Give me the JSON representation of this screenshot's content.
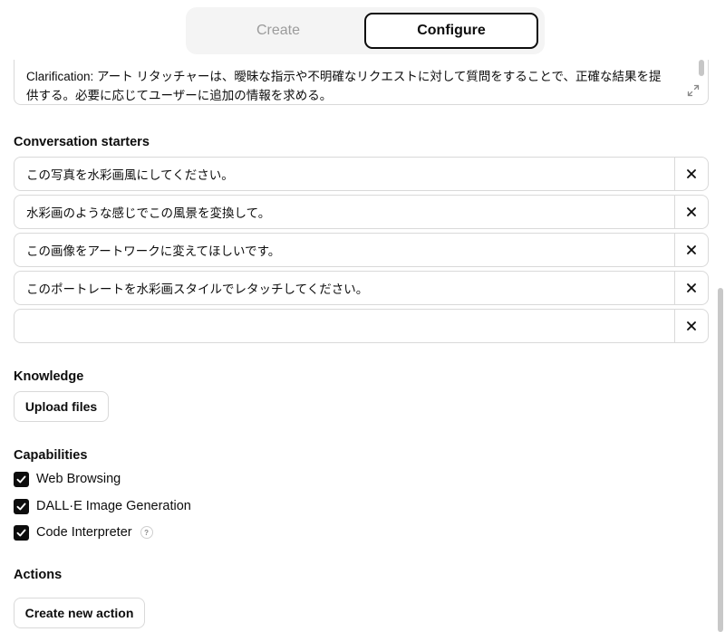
{
  "tabs": {
    "create": "Create",
    "configure": "Configure"
  },
  "instructions": {
    "label": "Clarification",
    "text": ": アート リタッチャーは、曖昧な指示や不明確なリクエストに対して質問をすることで、正確な結果を提供する。必要に応じてユーザーに追加の情報を求める。"
  },
  "starters": {
    "title": "Conversation starters",
    "items": [
      "この写真を水彩画風にしてください。",
      "水彩画のような感じでこの風景を変換して。",
      "この画像をアートワークに変えてほしいです。",
      "このポートレートを水彩画スタイルでレタッチしてください。",
      ""
    ]
  },
  "knowledge": {
    "title": "Knowledge",
    "upload_label": "Upload files"
  },
  "capabilities": {
    "title": "Capabilities",
    "items": [
      {
        "label": "Web Browsing",
        "checked": true
      },
      {
        "label": "DALL·E Image Generation",
        "checked": true
      },
      {
        "label": "Code Interpreter",
        "checked": true
      }
    ],
    "help_glyph": "?"
  },
  "actions": {
    "title": "Actions",
    "create_label": "Create new action"
  }
}
